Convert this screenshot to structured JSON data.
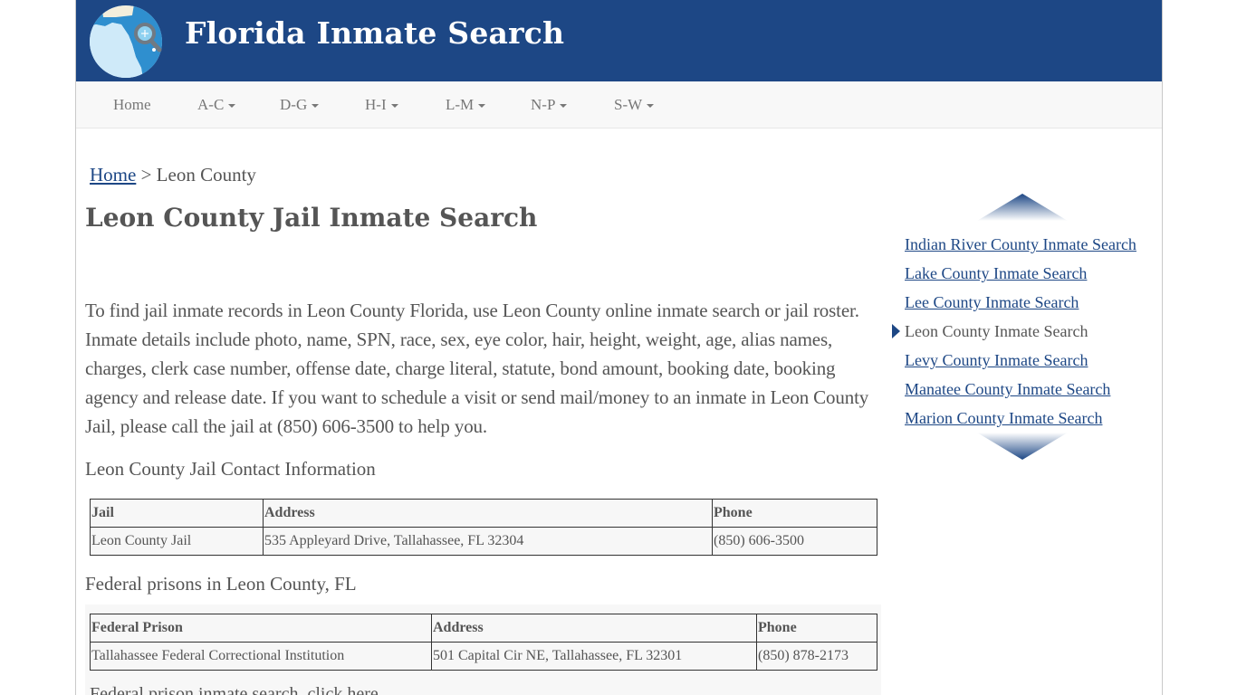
{
  "header": {
    "site_title": "Florida Inmate Search",
    "logo_icon": "florida-map-magnifier-icon",
    "brand_color": "#1d4785"
  },
  "nav": {
    "items": [
      {
        "label": "Home",
        "dropdown": false
      },
      {
        "label": "A-C",
        "dropdown": true
      },
      {
        "label": "D-G",
        "dropdown": true
      },
      {
        "label": "H-I",
        "dropdown": true
      },
      {
        "label": "L-M",
        "dropdown": true
      },
      {
        "label": "N-P",
        "dropdown": true
      },
      {
        "label": "S-W",
        "dropdown": true
      }
    ]
  },
  "breadcrumb": {
    "home": "Home",
    "separator": ">",
    "current": "Leon County"
  },
  "main": {
    "title": "Leon County Jail Inmate Search",
    "intro": "To find jail inmate records in Leon County Florida, use Leon County online inmate search or jail roster. Inmate details include photo, name, SPN, race, sex, eye color, hair, height, weight, age, alias names, charges, clerk case number, offense date, charge literal, statute, bond amount, booking date, booking agency and release date. If you want to schedule a visit or send mail/money to an inmate in Leon County Jail, please call the jail at (850) 606-3500 to help you.",
    "contact_heading": "Leon County Jail Contact Information",
    "jail_table": {
      "headers": [
        "Jail",
        "Address",
        "Phone"
      ],
      "rows": [
        [
          "Leon County Jail",
          "535 Appleyard Drive, Tallahassee, FL 32304",
          "(850) 606-3500"
        ]
      ]
    },
    "federal_heading": "Federal prisons in Leon County, FL",
    "federal_table": {
      "headers": [
        "Federal Prison",
        "Address",
        "Phone"
      ],
      "rows": [
        [
          "Tallahassee Federal Correctional Institution",
          "501 Capital Cir NE, Tallahassee, FL 32301",
          "(850) 878-2173"
        ]
      ]
    },
    "clipped_line": "Federal prison inmate search, click here"
  },
  "sidebar": {
    "scroll_up_icon": "chevron-up-icon",
    "scroll_down_icon": "chevron-down-icon",
    "items": [
      {
        "label": "Indian River County Inmate Search",
        "current": false
      },
      {
        "label": "Lake County Inmate Search",
        "current": false
      },
      {
        "label": "Lee County Inmate Search",
        "current": false
      },
      {
        "label": "Leon County Inmate Search",
        "current": true
      },
      {
        "label": "Levy County Inmate Search",
        "current": false
      },
      {
        "label": "Manatee County Inmate Search",
        "current": false
      },
      {
        "label": "Marion County Inmate Search",
        "current": false
      }
    ]
  }
}
